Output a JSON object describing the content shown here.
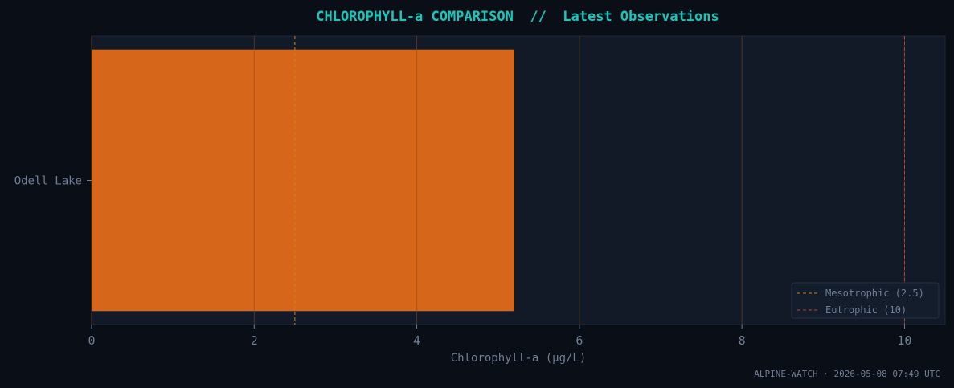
{
  "chart_data": {
    "type": "bar",
    "orientation": "horizontal",
    "title": "CHLOROPHYLL-a COMPARISON  //  Latest Observations",
    "categories": [
      "Odell Lake"
    ],
    "values": [
      5.2
    ],
    "xlabel": "Chlorophyll-a (µg/L)",
    "ylabel": "",
    "xlim": [
      0,
      10.5
    ],
    "xticks": [
      0,
      2,
      4,
      6,
      8,
      10
    ],
    "grid": true,
    "thresholds": [
      {
        "label": "Mesotrophic (2.5)",
        "value": 2.5,
        "color": "#c9851b"
      },
      {
        "label": "Eutrophic (10)",
        "value": 10,
        "color": "#b8413a"
      }
    ],
    "legend_position": "bottom-right",
    "footer": "ALPINE-WATCH · 2026-05-08 07:49 UTC",
    "colors": {
      "background": "#0a0e17",
      "plot_background": "#121a28",
      "bar": "#d66619",
      "title": "#16c7bb",
      "text": "#6e7d93"
    }
  }
}
